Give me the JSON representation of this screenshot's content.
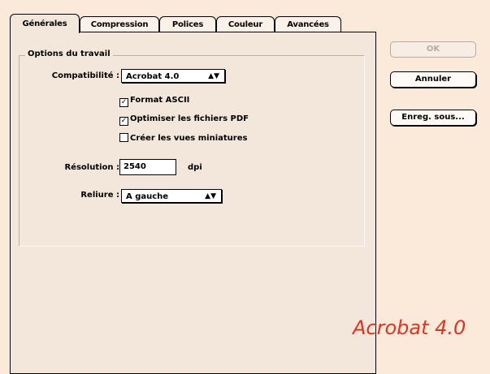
{
  "tabs": [
    "Générales",
    "Compression",
    "Polices",
    "Couleur",
    "Avancées"
  ],
  "group_title": "Options du travail",
  "compat": {
    "label": "Compatibilité :",
    "value": "Acrobat 4.0"
  },
  "checkboxes": [
    {
      "label": "Format ASCII",
      "checked": true
    },
    {
      "label": "Optimiser les fichiers PDF",
      "checked": true
    },
    {
      "label": "Créer les vues miniatures",
      "checked": false
    }
  ],
  "resolution": {
    "label": "Résolution :",
    "value": "2540",
    "unit": "dpi"
  },
  "binding": {
    "label": "Reliure :",
    "value": "A gauche"
  },
  "buttons": {
    "ok": "OK",
    "cancel": "Annuler",
    "save_as": "Enreg. sous..."
  },
  "caption": "Acrobat 4.0",
  "colors": {
    "background": "#fbe9da",
    "panel": "#f3e6da",
    "caption": "#e3331f"
  }
}
